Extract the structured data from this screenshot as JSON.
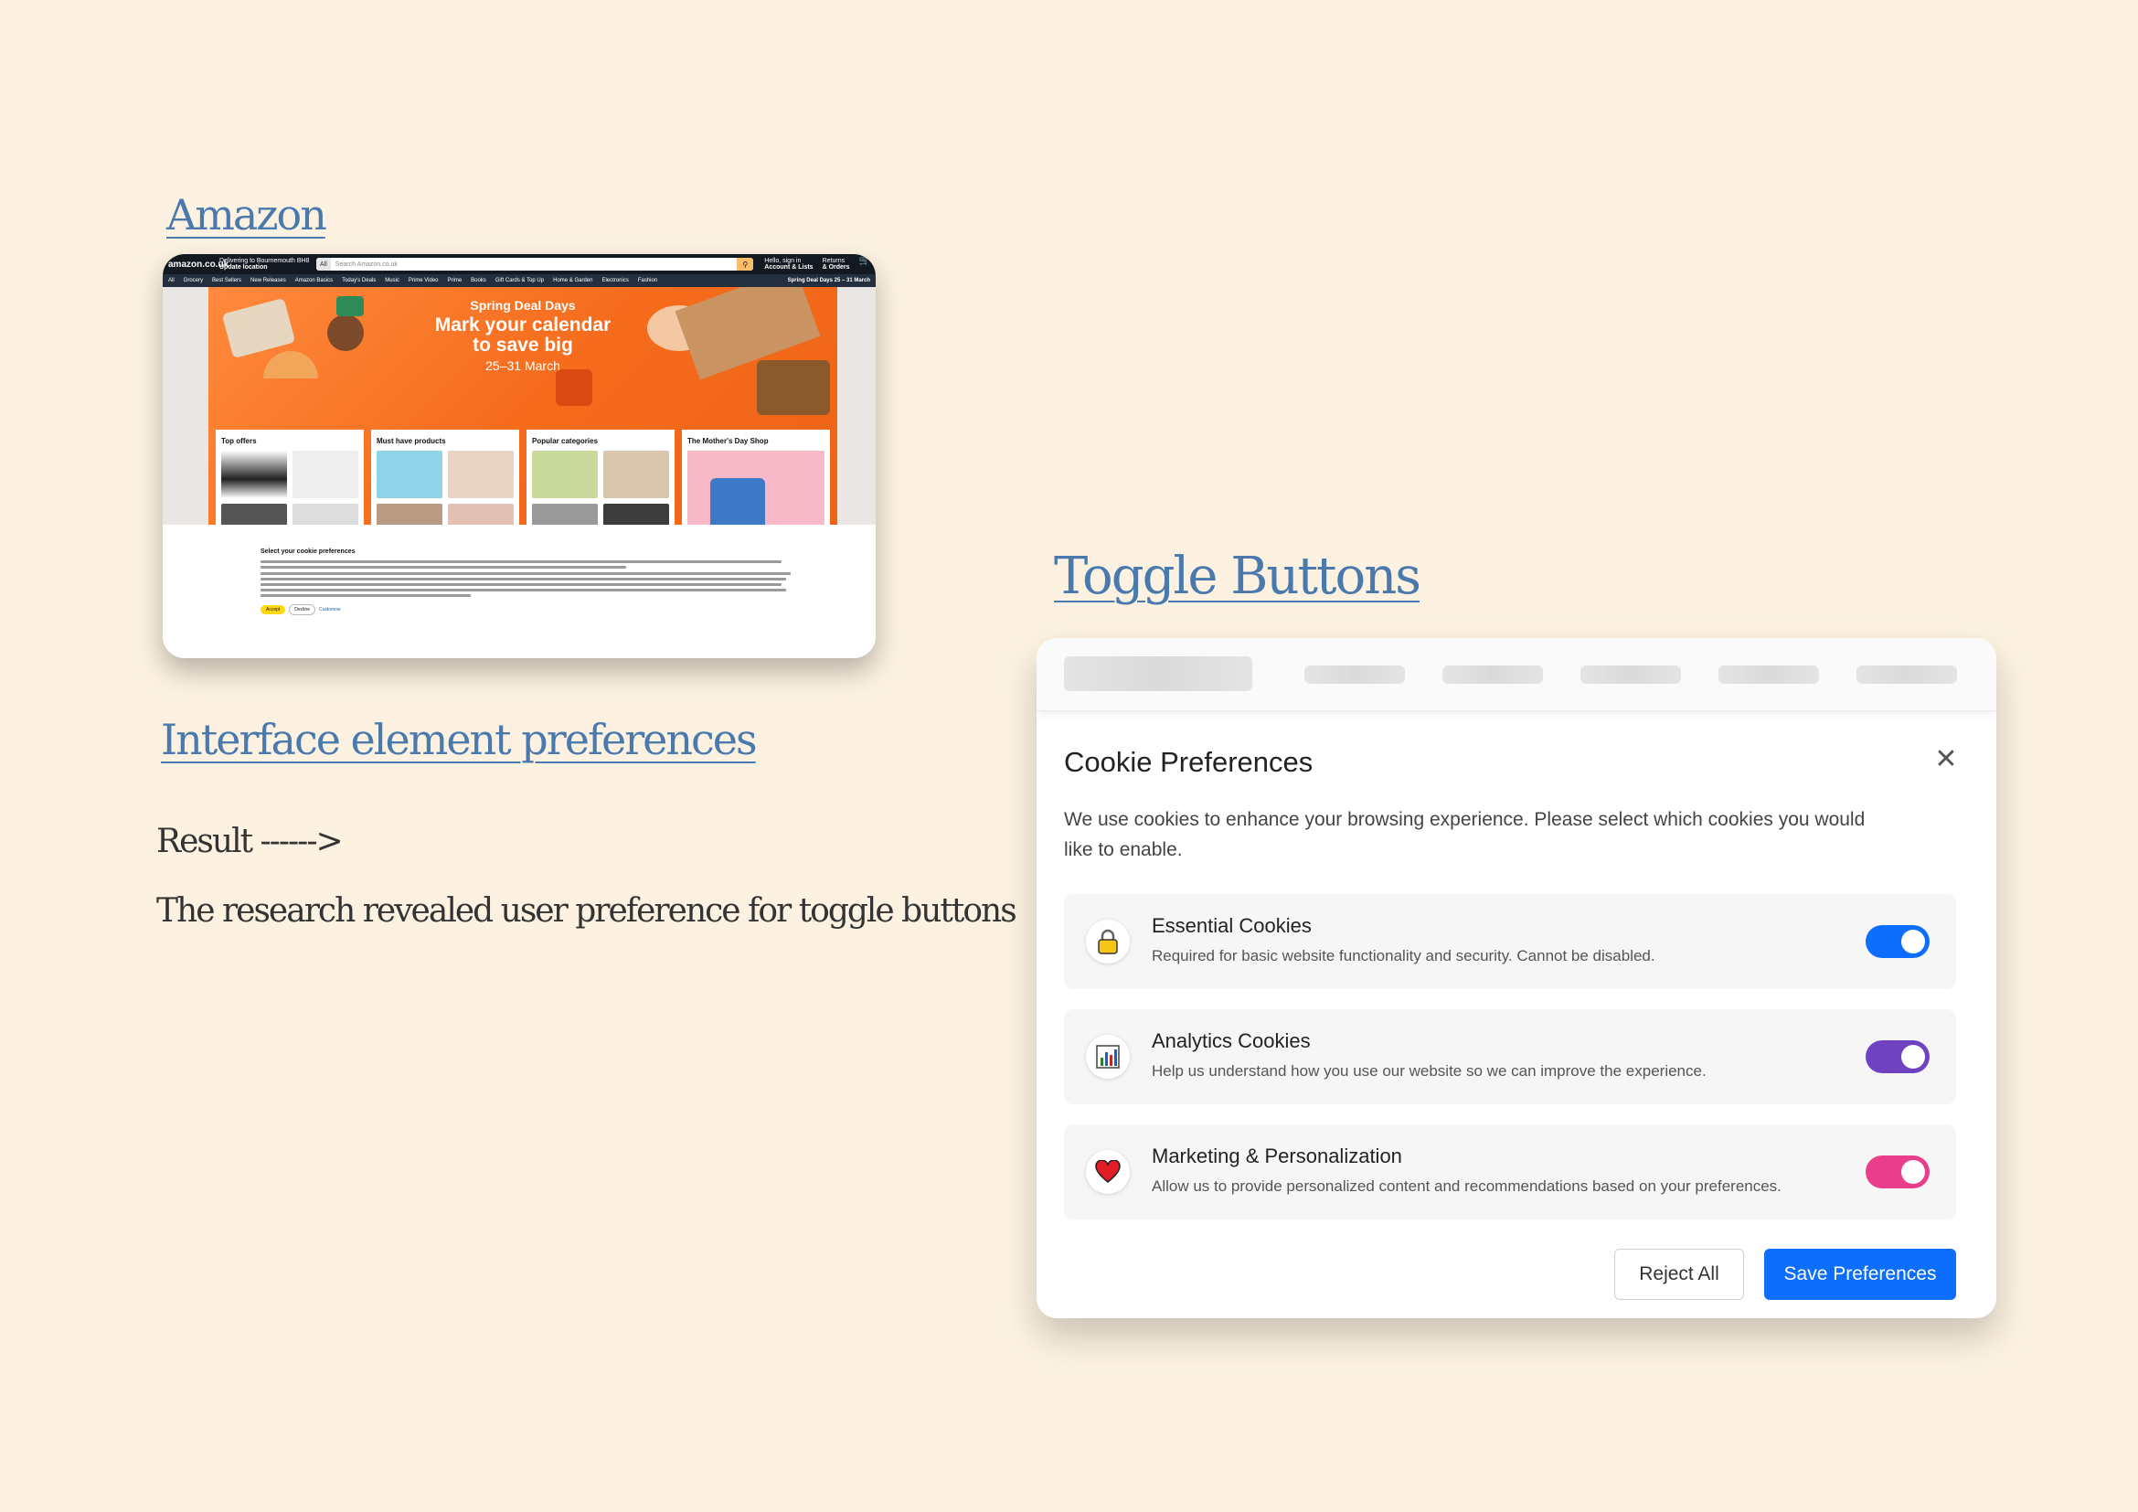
{
  "headings": {
    "amazon": "Amazon",
    "toggle_buttons": "Toggle Buttons",
    "interface_prefs": "Interface element preferences",
    "result": "Result ------>",
    "research": "The research revealed user preference for toggle buttons"
  },
  "amazon_screenshot": {
    "logo": "amazon.co.uk",
    "deliver_line1": "Delivering to Bournemouth BH8",
    "deliver_line2": "Update location",
    "search_scope": "All",
    "search_placeholder": "Search Amazon.co.uk",
    "account_line1": "Hello, sign in",
    "account_line2": "Account & Lists",
    "orders_line1": "Returns",
    "orders_line2": "& Orders",
    "nav_items": [
      "All",
      "Grocery",
      "Best Sellers",
      "New Releases",
      "Amazon Basics",
      "Today's Deals",
      "Music",
      "Prime Video",
      "Prime",
      "Books",
      "Gift Cards & Top Up",
      "Home & Garden",
      "Electronics",
      "Fashion"
    ],
    "nav_right": "Spring Deal Days 25 – 31 March",
    "banner_line1": "Spring Deal Days",
    "banner_line2": "Mark your calendar",
    "banner_line3": "to save big",
    "banner_line4": "25–31 March",
    "cards": [
      "Top offers",
      "Must have products",
      "Popular categories",
      "The Mother's Day Shop"
    ],
    "cookie_title": "Select your cookie preferences",
    "accept": "Accept",
    "decline": "Decline",
    "customise": "Customise"
  },
  "cookie_dialog": {
    "title": "Cookie Preferences",
    "close_icon": "close-icon",
    "description": "We use cookies to enhance your browsing experience. Please select which cookies you would like to enable.",
    "items": [
      {
        "name": "Essential Cookies",
        "description": "Required for basic website functionality and security. Cannot be disabled.",
        "icon": "lock-icon",
        "enabled": true,
        "color": "#0d6efd"
      },
      {
        "name": "Analytics Cookies",
        "description": "Help us understand how you use our website so we can improve the experience.",
        "icon": "bar-chart-icon",
        "enabled": true,
        "color": "#6f42c1"
      },
      {
        "name": "Marketing & Personalization",
        "description": "Allow us to provide personalized content and recommendations based on your preferences.",
        "icon": "heart-icon",
        "enabled": true,
        "color": "#e83e8c"
      }
    ],
    "reject_label": "Reject All",
    "save_label": "Save Preferences"
  },
  "colors": {
    "background": "#fdf2e1",
    "link": "#4a79ad",
    "primary": "#0d6efd"
  }
}
